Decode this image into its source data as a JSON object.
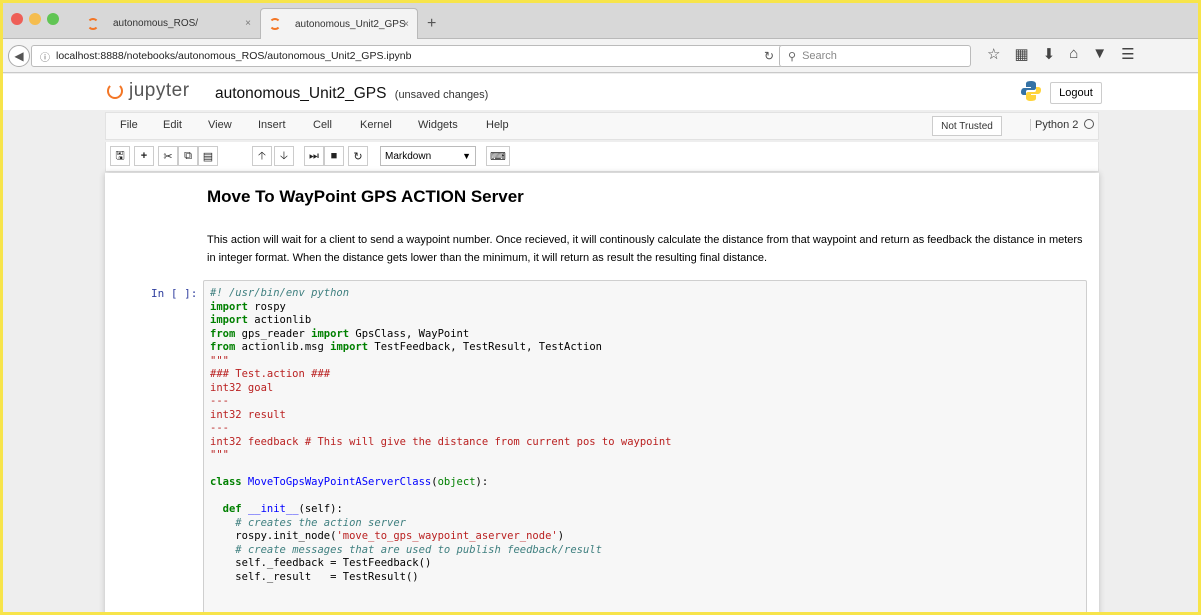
{
  "browser": {
    "tabs": [
      {
        "label": "autonomous_ROS/",
        "active": false
      },
      {
        "label": "autonomous_Unit2_GPS",
        "active": true
      }
    ],
    "tab_close": "×",
    "new_tab": "+",
    "url": "localhost:8888/notebooks/autonomous_ROS/autonomous_Unit2_GPS.ipynb",
    "search_placeholder": "Search",
    "colors": {
      "close": "#ee5f57",
      "minimize": "#f5bd4f",
      "maximize": "#61c554"
    }
  },
  "jupyter": {
    "logo_text": "jupyter",
    "notebook_name": "autonomous_Unit2_GPS",
    "save_status": "(unsaved changes)",
    "logout_label": "Logout",
    "menu": [
      "File",
      "Edit",
      "View",
      "Insert",
      "Cell",
      "Kernel",
      "Widgets",
      "Help"
    ],
    "trust_label": "Not Trusted",
    "kernel_name": "Python 2",
    "cell_type": "Markdown"
  },
  "cells": {
    "md_title": "Move To WayPoint GPS ACTION Server",
    "md_text": "This action will wait for a client to send a waypoint number. Once recieved, it will continously calculate the distance from that waypoint and return as feedback the distance in meters in integer format. When the distance gets lower than the minimum, it will return as result the resulting final distance.",
    "prompt": "In [ ]:",
    "code": {
      "l1": "#! /usr/bin/env python",
      "l2_kw": "import",
      "l2": " rospy",
      "l3_kw": "import",
      "l3": " actionlib",
      "l4_kw1": "from",
      "l4_mod": " gps_reader ",
      "l4_kw2": "import",
      "l4_rest": " GpsClass, WayPoint",
      "l5_kw1": "from",
      "l5_mod": " actionlib.msg ",
      "l5_kw2": "import",
      "l5_rest": " TestFeedback, TestResult, TestAction",
      "l6": "\"\"\"",
      "l7": "### Test.action ###",
      "l8": "int32 goal",
      "l9": "---",
      "l10": "int32 result",
      "l11": "---",
      "l12": "int32 feedback # This will give the distance from current pos to waypoint",
      "l13": "\"\"\"",
      "l15_kw": "class",
      "l15_name": " MoveToGpsWayPointAServerClass",
      "l15_rest1": "(",
      "l15_bi": "object",
      "l15_rest2": "):",
      "l17_kw": "def",
      "l17_name": " __init__",
      "l17_rest": "(self):",
      "l18": "# creates the action server",
      "l19a": "rospy.init_node(",
      "l19s": "'move_to_gps_waypoint_aserver_node'",
      "l19b": ")",
      "l20": "# create messages that are used to publish feedback/result",
      "l21": "self._feedback = TestFeedback()",
      "l22": "self._result   = TestResult()"
    }
  }
}
